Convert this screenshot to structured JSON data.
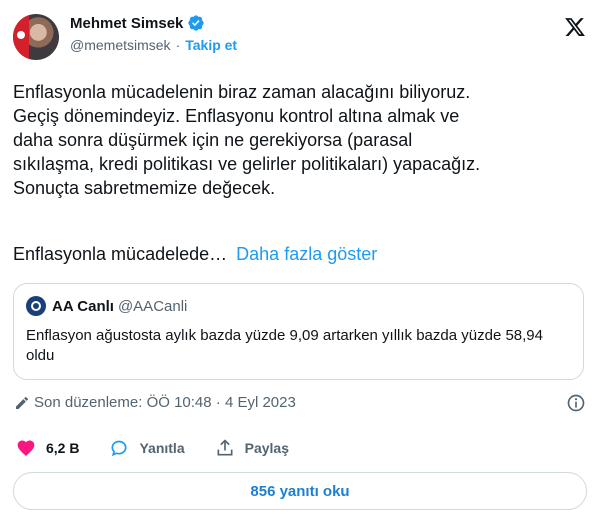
{
  "author": {
    "name": "Mehmet Simsek",
    "handle": "@memetsimsek",
    "follow_label": "Takip et",
    "separator": "·"
  },
  "tweet": {
    "text": "Enflasyonla mücadelenin biraz zaman alacağını biliyoruz.\nGeçiş dönemindeyiz. Enflasyonu kontrol altına almak ve\ndaha sonra düşürmek için ne gerekiyorsa (parasal\nsıkılaşma, kredi politikası ve gelirler politikaları) yapacağız.\nSonuçta sabretmemize değecek.",
    "truncated_text": "Enflasyonla mücadelede…",
    "show_more_label": "Daha fazla göster"
  },
  "quote": {
    "name": "AA Canlı",
    "handle": "@AACanli",
    "text": "Enflasyon ağustosta aylık bazda yüzde 9,09 artarken yıllık bazda yüzde 58,94 oldu"
  },
  "meta": {
    "edited_text": "Son düzenleme: ÖÖ 10:48 · 4 Eyl 2023"
  },
  "actions": {
    "likes": "6,2 B",
    "reply_label": "Yanıtla",
    "share_label": "Paylaş"
  },
  "replies_button": "856 yanıtı oku",
  "colors": {
    "accent": "#1d9bf0",
    "like": "#f91880",
    "text": "#0f1419",
    "secondary": "#536471",
    "border": "#cfd9de"
  },
  "icons": [
    "verified-badge-icon",
    "x-logo-icon",
    "pencil-icon",
    "info-icon",
    "heart-icon",
    "reply-icon",
    "share-icon"
  ]
}
